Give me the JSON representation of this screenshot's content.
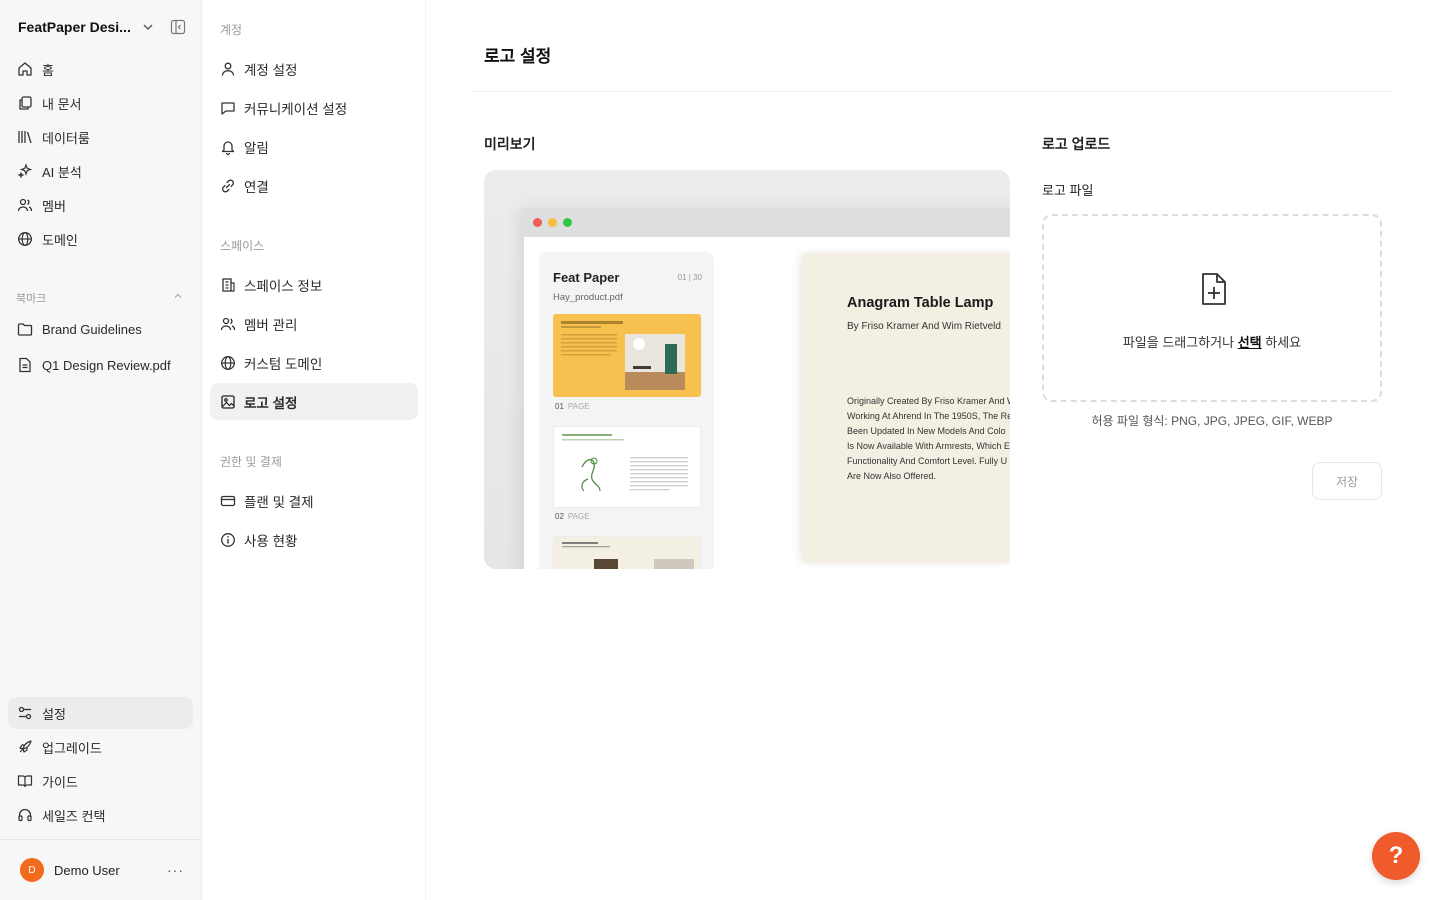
{
  "sidebar": {
    "workspace_name": "FeatPaper Desi...",
    "nav": [
      {
        "label": "홈"
      },
      {
        "label": "내 문서"
      },
      {
        "label": "데이터룸"
      },
      {
        "label": "AI 분석"
      },
      {
        "label": "멤버"
      },
      {
        "label": "도메인"
      }
    ],
    "bookmarks_label": "북마크",
    "bookmarks": [
      {
        "label": "Brand Guidelines"
      },
      {
        "label": "Q1 Design Review.pdf"
      }
    ],
    "bottom_nav": [
      {
        "label": "설정"
      },
      {
        "label": "업그레이드"
      },
      {
        "label": "가이드"
      },
      {
        "label": "세일즈 컨택"
      }
    ],
    "user": {
      "initial": "D",
      "name": "Demo User",
      "more": "···"
    }
  },
  "subnav": {
    "account_label": "계정",
    "account_items": [
      {
        "label": "계정 설정"
      },
      {
        "label": "커뮤니케이션 설정"
      },
      {
        "label": "알림"
      },
      {
        "label": "연결"
      }
    ],
    "space_label": "스페이스",
    "space_items": [
      {
        "label": "스페이스 정보"
      },
      {
        "label": "멤버 관리"
      },
      {
        "label": "커스텀 도메인"
      },
      {
        "label": "로고 설정"
      }
    ],
    "billing_label": "권한 및 결제",
    "billing_items": [
      {
        "label": "플랜 및 결제"
      },
      {
        "label": "사용 현황"
      }
    ]
  },
  "main": {
    "title": "로고 설정",
    "preview_label": "미리보기",
    "preview": {
      "brand": "Feat Paper",
      "file_name": "Hay_product.pdf",
      "page_count": "01 | 30",
      "thumbs": [
        {
          "num": "01",
          "page": "PAGE"
        },
        {
          "num": "02",
          "page": "PAGE"
        }
      ],
      "doc_title": "Anagram Table Lamp",
      "doc_subtitle": "By Friso Kramer And Wim Rietveld",
      "doc_lines": [
        "Originally Created By Friso Kramer And W",
        "Working At Ahrend In The 1950S, The Re",
        "Been Updated In New Models And Colo",
        "Is Now Available With Armrests, Which E",
        "Functionality And Comfort Level. Fully U",
        "Are Now Also Offered."
      ]
    },
    "upload_label": "로고 업로드",
    "file_label": "로고 파일",
    "drop_text_before": "파일을 드래그하거나 ",
    "drop_select": "선택",
    "drop_text_after": " 하세요",
    "formats": "허용 파일 형식: PNG, JPG, JPEG, GIF, WEBP",
    "save_label": "저장",
    "help_label": "?"
  },
  "colors": {
    "accent": "#f15a2b",
    "avatar": "#f26b1d",
    "sidebar_bg": "#f7f7f7"
  }
}
